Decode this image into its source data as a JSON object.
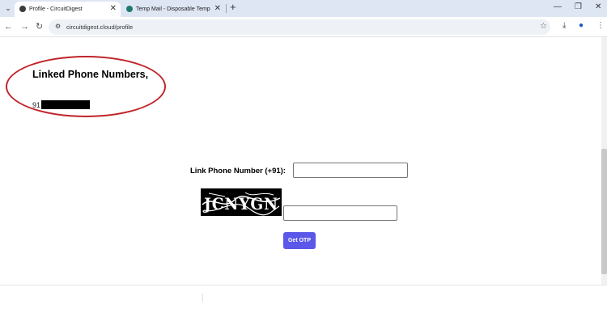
{
  "browser": {
    "tabs": [
      {
        "title": "Profile - CircuitDigest",
        "favicon_color": "#3b3b3b",
        "close": "✕"
      },
      {
        "title": "Temp Mail - Disposable Tempo",
        "favicon_color": "#1f7a6b",
        "close": "✕"
      }
    ],
    "new_tab": "+",
    "url": "circuitdigest.cloud/profile"
  },
  "page": {
    "linked_heading": "Linked Phone Numbers,",
    "linked_phone_prefix": "91",
    "link_label": "Link Phone Number (+91):",
    "phone_value": "",
    "captcha_value": "",
    "captcha_text": "JCNYGN",
    "get_otp_label": "Get OTP"
  },
  "colors": {
    "annotation": "#c0242a",
    "button": "#5b57e8"
  }
}
